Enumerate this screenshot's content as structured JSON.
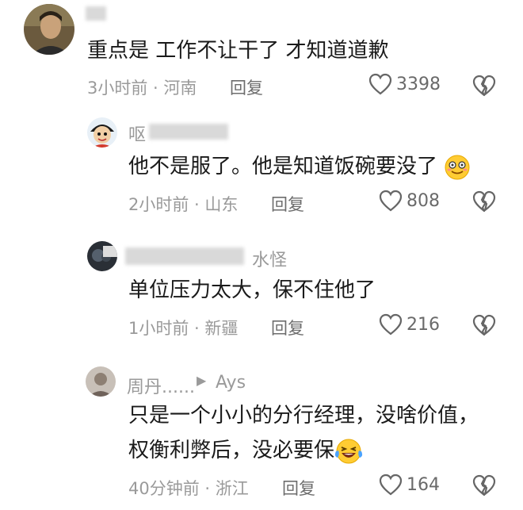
{
  "comments": [
    {
      "username": "",
      "text": "重点是 工作不让干了 才知道道歉",
      "time": "3小时前",
      "location": "河南",
      "reply_label": "回复",
      "likes": "3398"
    },
    {
      "username": "呕",
      "text": "他不是服了。他是知道饭碗要没了",
      "time": "2小时前",
      "location": "山东",
      "reply_label": "回复",
      "likes": "808",
      "emoji": "smiling-face-emoji"
    },
    {
      "username": "水怪",
      "text": "单位压力太大，保不住他了",
      "time": "1小时前",
      "location": "新疆",
      "reply_label": "回复",
      "likes": "216"
    },
    {
      "username": "周丹......",
      "reply_to": "Ays",
      "text_line1": "只是一个小小的分行经理，没啥价值，",
      "text_line2": "权衡利弊后，没必要保",
      "time": "40分钟前",
      "location": "浙江",
      "reply_label": "回复",
      "likes": "164",
      "emoji": "laughing-tears-emoji"
    }
  ],
  "colors": {
    "text": "#1a1a1a",
    "meta": "#9a9a9a",
    "icon": "#666666",
    "emoji_yellow": "#ffcc33"
  }
}
